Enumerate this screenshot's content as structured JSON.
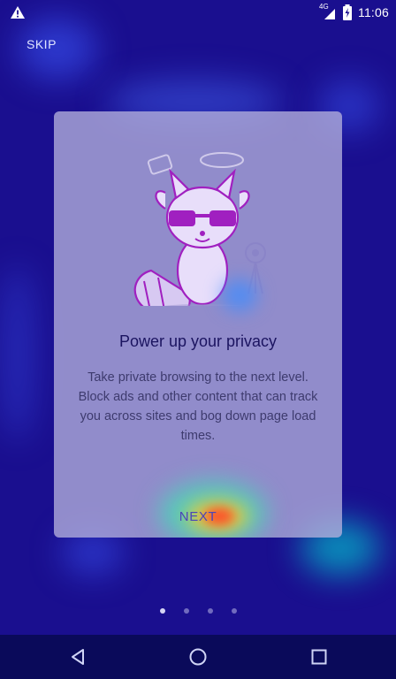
{
  "status_bar": {
    "network": "4G",
    "time": "11:06",
    "warning_icon": "warning-triangle-icon",
    "signal_icon": "signal-icon",
    "battery_icon": "battery-charging-icon"
  },
  "onboarding": {
    "skip_label": "SKIP",
    "title": "Power up your privacy",
    "description": "Take private browsing to the next level. Block ads and other content that can track you across sites and bog down page load times.",
    "next_label": "NEXT",
    "illustration": "raccoon-sunglasses-illustration",
    "page_count": 4,
    "current_page": 1
  },
  "nav_bar": {
    "back_icon": "back-triangle-icon",
    "home_icon": "home-circle-icon",
    "recents_icon": "recents-square-icon"
  },
  "colors": {
    "background": "#1a0f8f",
    "card": "#b4afdc",
    "title": "#1b1460",
    "accent": "#4c44b8"
  }
}
